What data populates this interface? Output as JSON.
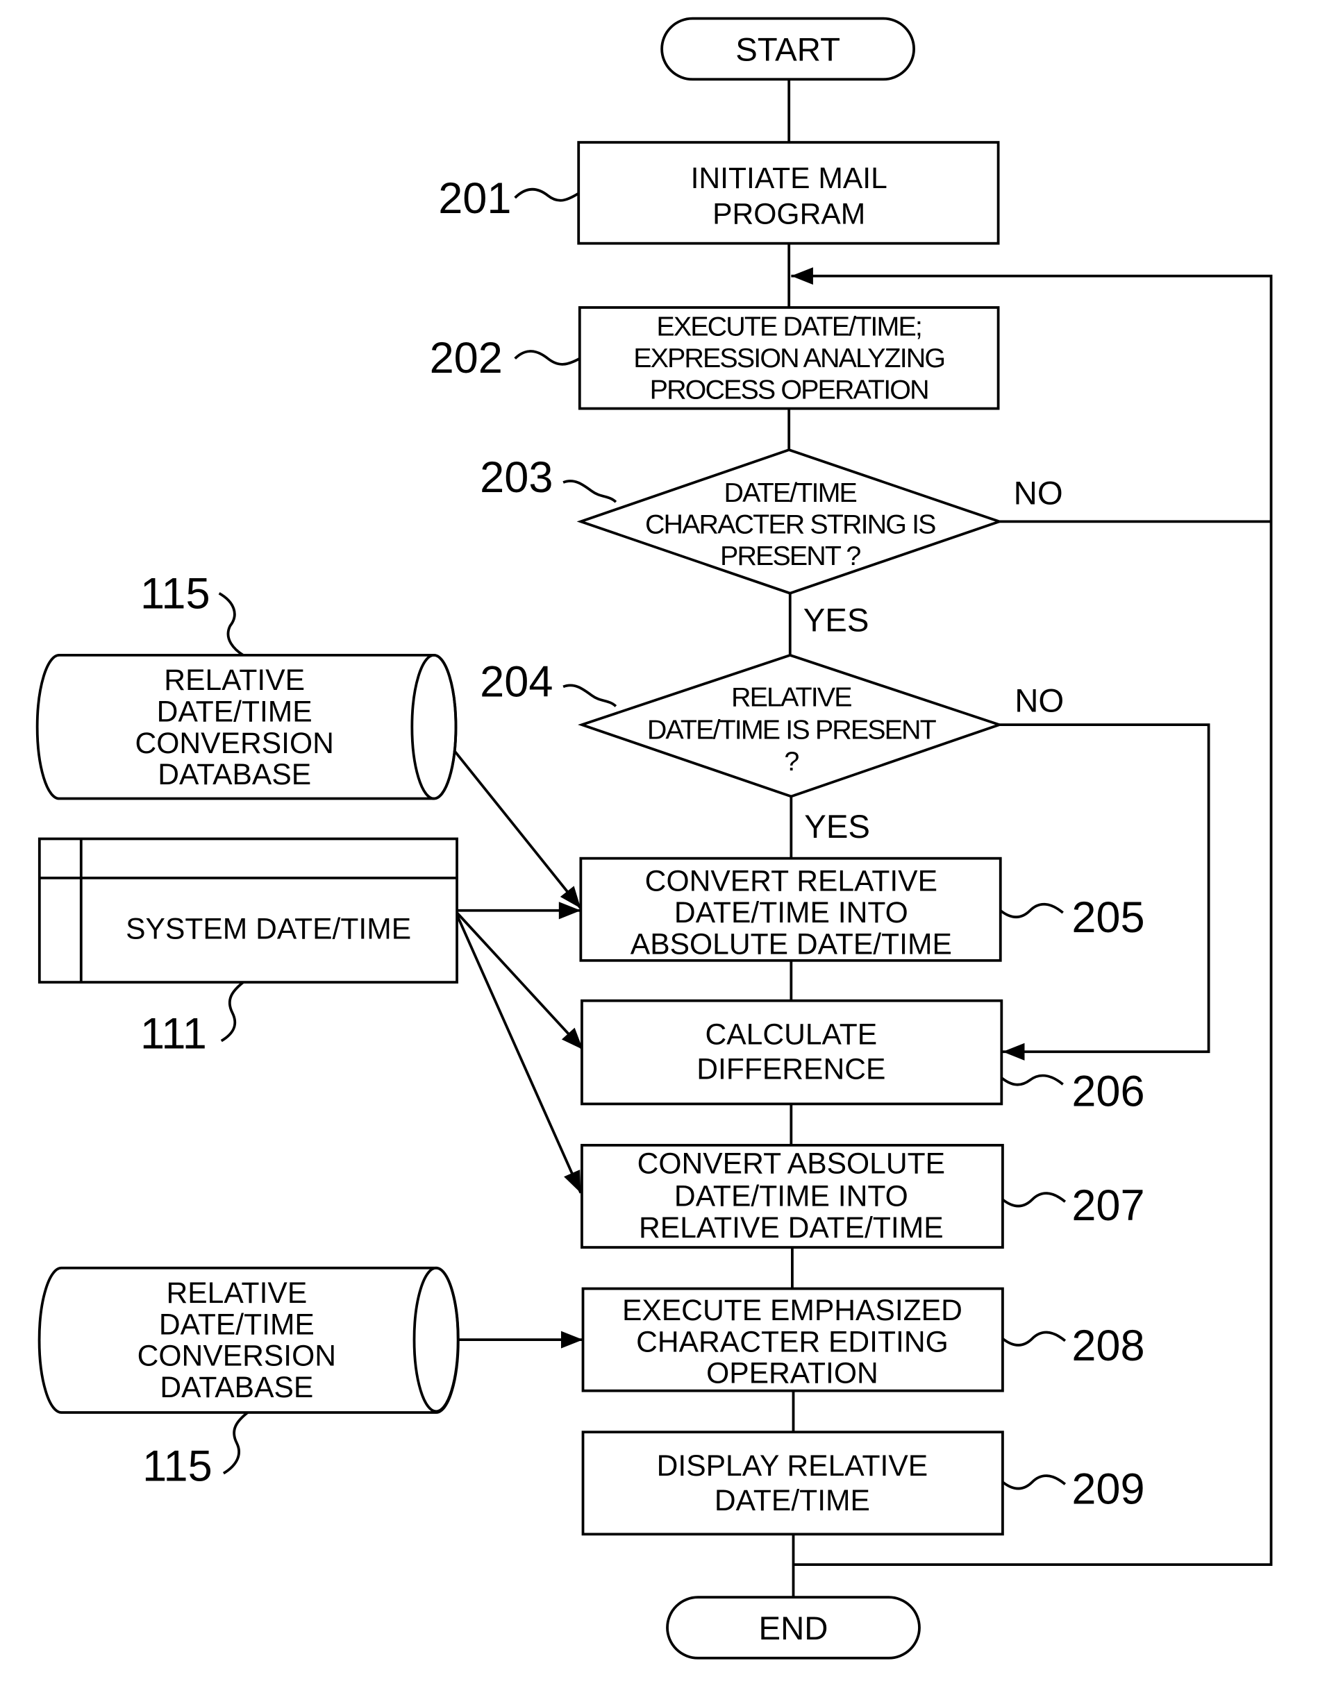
{
  "diagram": {
    "type": "flowchart",
    "terminals": {
      "start": "START",
      "end": "END"
    },
    "steps": [
      {
        "ref": "201",
        "kind": "process",
        "lines": [
          "INITIATE MAIL",
          "PROGRAM"
        ]
      },
      {
        "ref": "202",
        "kind": "process",
        "lines": [
          "EXECUTE DATE/TIME;",
          "EXPRESSION ANALYZING",
          "PROCESS OPERATION"
        ]
      },
      {
        "ref": "203",
        "kind": "decision",
        "lines": [
          "DATE/TIME",
          "CHARACTER STRING IS",
          "PRESENT ?"
        ],
        "yes": "YES",
        "no": "NO"
      },
      {
        "ref": "204",
        "kind": "decision",
        "lines": [
          "RELATIVE",
          "DATE/TIME IS PRESENT",
          "?"
        ],
        "yes": "YES",
        "no": "NO"
      },
      {
        "ref": "205",
        "kind": "process",
        "lines": [
          "CONVERT RELATIVE",
          "DATE/TIME INTO",
          "ABSOLUTE DATE/TIME"
        ]
      },
      {
        "ref": "206",
        "kind": "process",
        "lines": [
          "CALCULATE",
          "DIFFERENCE"
        ]
      },
      {
        "ref": "207",
        "kind": "process",
        "lines": [
          "CONVERT ABSOLUTE",
          "DATE/TIME INTO",
          "RELATIVE DATE/TIME"
        ]
      },
      {
        "ref": "208",
        "kind": "process",
        "lines": [
          "EXECUTE EMPHASIZED",
          "CHARACTER EDITING",
          "OPERATION"
        ]
      },
      {
        "ref": "209",
        "kind": "process",
        "lines": [
          "DISPLAY RELATIVE",
          "DATE/TIME"
        ]
      }
    ],
    "data_stores": [
      {
        "ref": "115",
        "kind": "database",
        "lines": [
          "RELATIVE",
          "DATE/TIME",
          "CONVERSION",
          "DATABASE"
        ],
        "feeds": "205"
      },
      {
        "ref": "111",
        "kind": "table",
        "lines": [
          "SYSTEM DATE/TIME"
        ],
        "feeds": [
          "205",
          "206",
          "207"
        ]
      },
      {
        "ref": "115",
        "kind": "database",
        "lines": [
          "RELATIVE",
          "DATE/TIME",
          "CONVERSION",
          "DATABASE"
        ],
        "feeds": "208"
      }
    ],
    "edges": [
      {
        "from": "START",
        "to": "201"
      },
      {
        "from": "201",
        "to": "202"
      },
      {
        "from": "202",
        "to": "203"
      },
      {
        "from": "203",
        "to": "204",
        "label": "YES"
      },
      {
        "from": "203",
        "to": "202",
        "label": "NO"
      },
      {
        "from": "204",
        "to": "205",
        "label": "YES"
      },
      {
        "from": "204",
        "to": "206",
        "label": "NO"
      },
      {
        "from": "205",
        "to": "206"
      },
      {
        "from": "206",
        "to": "207"
      },
      {
        "from": "207",
        "to": "208"
      },
      {
        "from": "208",
        "to": "209"
      },
      {
        "from": "209",
        "to": "202"
      },
      {
        "from": "209",
        "to": "END"
      }
    ]
  }
}
